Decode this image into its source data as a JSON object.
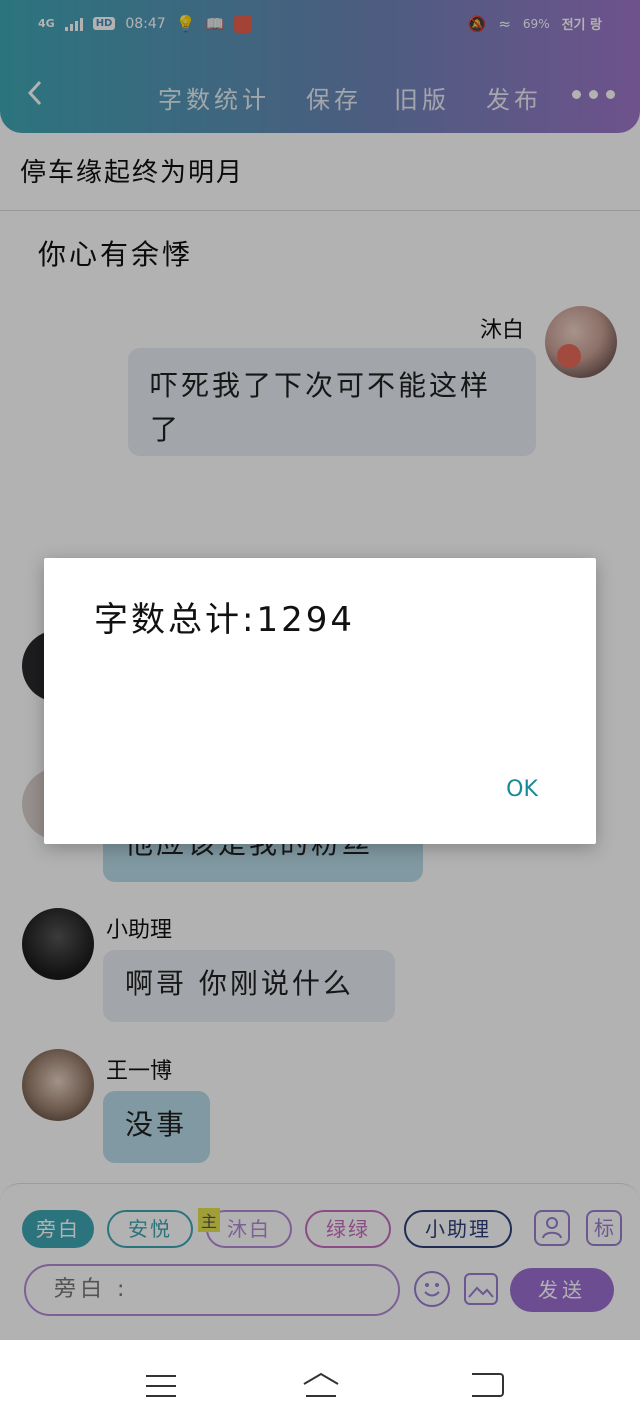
{
  "status_bar": {
    "network": "4G",
    "hd": "HD",
    "time": "08:47",
    "battery": "69%",
    "carrier": "전기 랑"
  },
  "nav": {
    "word_count_label": "字数统计",
    "save_label": "保存",
    "old_version_label": "旧版",
    "publish_label": "发布"
  },
  "document": {
    "title": "停车缘起终为明月",
    "subtitle": "你心有余悸"
  },
  "messages": [
    {
      "speaker": "沐白",
      "text": "吓死我了下次可不能这样了"
    },
    {
      "speaker": "",
      "text": "他应该是我的粉丝"
    },
    {
      "speaker": "小助理",
      "text": "啊哥 你刚说什么"
    },
    {
      "speaker": "王一博",
      "text": "没事"
    }
  ],
  "composer": {
    "roles": [
      {
        "label": "旁白",
        "color": "#3fa7b4"
      },
      {
        "label": "安悦",
        "color": "#3fa7b4"
      },
      {
        "label": "沐白",
        "color": "#b38ad6",
        "badge": "主"
      },
      {
        "label": "绿绿",
        "color": "#c86ec0"
      },
      {
        "label": "小助理",
        "color": "#2f3f7a"
      }
    ],
    "tag_button": "标",
    "input_placeholder": "旁白 :",
    "send_label": "发送"
  },
  "dialog": {
    "message": "字数总计:1294",
    "ok_label": "OK"
  },
  "colors": {
    "header_start": "#3fa7b4",
    "header_end": "#9e76c8",
    "accent_purple": "#9b6fd2",
    "dialog_button": "#1a8a95"
  }
}
